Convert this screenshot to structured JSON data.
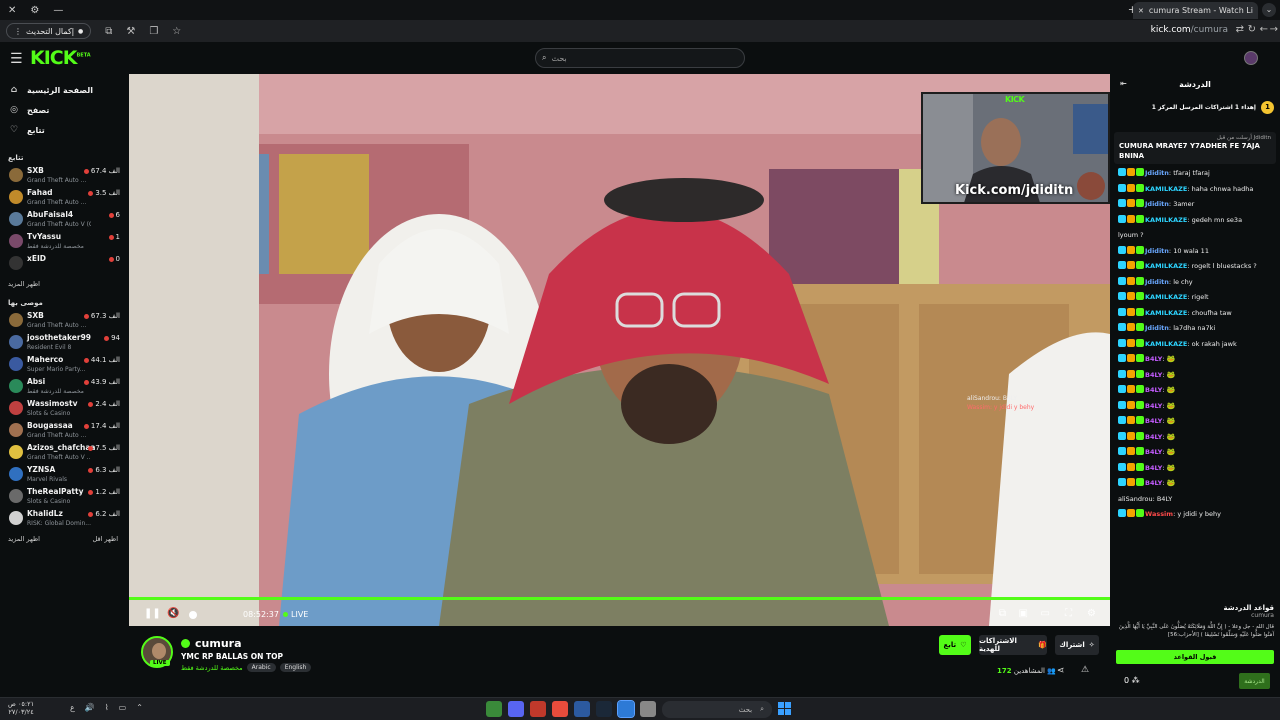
{
  "browser": {
    "tab_title": "cumura Stream - Watch Li",
    "update_label": "إكمال التحديث",
    "url_host": "kick.com",
    "url_path": "/cumura"
  },
  "header": {
    "logo": "KICK",
    "logo_sup": "BETA",
    "search_placeholder": "بحث"
  },
  "sidebar": {
    "nav": [
      {
        "label": "الصفحة الرئيسية",
        "icon": "home-icon"
      },
      {
        "label": "تصفح",
        "icon": "compass-icon"
      },
      {
        "label": "تتابع",
        "icon": "heart-icon"
      }
    ],
    "following_heading": "تتابع",
    "following": [
      {
        "name": "SXB",
        "game": "Grand Theft Auto ...",
        "viewers": "67.4 الف",
        "color": "#8a6a3a"
      },
      {
        "name": "Fahad",
        "game": "Grand Theft Auto ...",
        "viewers": "3.5 الف",
        "color": "#c08a2a"
      },
      {
        "name": "AbuFaisal4",
        "game": "Grand Theft Auto V (GTA)",
        "viewers": "6",
        "color": "#5a7a9a"
      },
      {
        "name": "TvYassu",
        "game": "مخصصة للدردشة فقط",
        "viewers": "1",
        "color": "#7a4a6a"
      },
      {
        "name": "xEID",
        "game": "",
        "viewers": "0",
        "color": "#333333"
      }
    ],
    "show_more": "اظهر المزيد",
    "recommended_heading": "موصى بها",
    "recommended": [
      {
        "name": "SXB",
        "game": "Grand Theft Auto ...",
        "viewers": "67.3 الف",
        "color": "#8a6a3a"
      },
      {
        "name": "josothetaker99",
        "game": "Resident Evil 8",
        "viewers": "94",
        "color": "#4a6aa0"
      },
      {
        "name": "Maherco",
        "game": "Super Mario Party...",
        "viewers": "44.1 الف",
        "color": "#3a5aa0"
      },
      {
        "name": "Absi",
        "game": "مخصصة للدردشة فقط",
        "viewers": "43.9 الف",
        "color": "#2a8a5a"
      },
      {
        "name": "Wassimostv",
        "game": "Slots & Casino",
        "viewers": "2.4 الف",
        "color": "#c04040"
      },
      {
        "name": "Bougassaa",
        "game": "Grand Theft Auto ...",
        "viewers": "17.4 الف",
        "color": "#a07050"
      },
      {
        "name": "Azizos_chafchaa",
        "game": "Grand Theft Auto V ...",
        "viewers": "7.5 الف",
        "color": "#e0c040"
      },
      {
        "name": "YZNSA",
        "game": "Marvel Rivals",
        "viewers": "6.3 الف",
        "color": "#3070c0"
      },
      {
        "name": "TheRealPatty",
        "game": "Slots & Casino",
        "viewers": "1.2 الف",
        "color": "#6a6a6a"
      },
      {
        "name": "KhalidLz",
        "game": "RISK: Global Domin...",
        "viewers": "6.2 الف",
        "color": "#d0d0d0"
      }
    ],
    "show_more2": "اظهر المزيد",
    "show_less": "اظهر اقل"
  },
  "player": {
    "cam_logo": "KICK",
    "cam_url": "Kick.com/jdiditn",
    "time": "08:52:37",
    "live": "LIVE",
    "overlay_chat": [
      "aliSandrou: B4LY",
      "Wassim: y jdidi y behy"
    ]
  },
  "stream": {
    "streamer": "cumura",
    "live_badge": "LIVE",
    "title": "YMC RP BALLAS ON TOP",
    "category": "مخصصة للدردشة فقط",
    "tags": [
      "Arabic",
      "English"
    ],
    "follow": "تابع",
    "subs": "الاشتراكات للهدية",
    "gift": "اشتراك",
    "viewers_label": "المشاهدين",
    "viewers": "172"
  },
  "chat": {
    "title": "الدردشة",
    "gift_count": "1",
    "gift_text": "إهداء 1 اشتراكات المرسل المركز 1",
    "pinned_by": "أرسلت من قبل Jdiditn",
    "pinned_msg": "CUMURA MRAYE7 Y7ADHER FE 7AJA BNINA",
    "messages": [
      {
        "user": "Jdiditn",
        "cls": "u1",
        "text": "tfaraj tfaraj"
      },
      {
        "user": "KAMILKAZE",
        "cls": "u2",
        "text": "haha chnwa hadha"
      },
      {
        "user": "Jdiditn",
        "cls": "u1",
        "text": "3amer"
      },
      {
        "user": "KAMILKAZE",
        "cls": "u2",
        "text": "gedeh mn se3a"
      },
      {
        "user": "",
        "cls": "",
        "text": "lyoum ?"
      },
      {
        "user": "Jdiditn",
        "cls": "u1",
        "text": "10 wala 11"
      },
      {
        "user": "KAMILKAZE",
        "cls": "u2",
        "text": "rogelt l bluestacks ?"
      },
      {
        "user": "Jdiditn",
        "cls": "u1",
        "text": "le chy"
      },
      {
        "user": "KAMILKAZE",
        "cls": "u2",
        "text": "rigelt"
      },
      {
        "user": "KAMILKAZE",
        "cls": "u2",
        "text": "choufha taw"
      },
      {
        "user": "Jdiditn",
        "cls": "u1",
        "text": "la7dha na7ki"
      },
      {
        "user": "KAMILKAZE",
        "cls": "u2",
        "text": "ok rakah jawk"
      },
      {
        "user": "B4LY",
        "cls": "u3",
        "text": ""
      },
      {
        "user": "B4LY",
        "cls": "u3",
        "text": ""
      },
      {
        "user": "B4LY",
        "cls": "u3",
        "text": ""
      },
      {
        "user": "B4LY",
        "cls": "u3",
        "text": ""
      },
      {
        "user": "B4LY",
        "cls": "u3",
        "text": ""
      },
      {
        "user": "B4LY",
        "cls": "u3",
        "text": ""
      },
      {
        "user": "B4LY",
        "cls": "u3",
        "text": ""
      },
      {
        "user": "B4LY",
        "cls": "u3",
        "text": ""
      },
      {
        "user": "B4LY",
        "cls": "u3",
        "text": ""
      },
      {
        "user": "aliSandrou",
        "cls": "",
        "text": "B4LY"
      },
      {
        "user": "Wassim",
        "cls": "u4",
        "text": "y jdidi y behy"
      }
    ],
    "rules_title": "قواعد الدردشة",
    "rules_sub": "cumura",
    "rules_body": "قال الله - جل وعلا - ( إِنَّ اللَّهَ وَمَلَائِكَتَهُ يُصَلُّونَ عَلَى النَّبِيِّ يَا أَيُّهَا الَّذِينَ آمَنُوا صَلُّوا عَلَيْهِ وَسَلِّمُوا تَسْلِيمًا ) [الأحزاب:56]",
    "accept": "قبول القواعد",
    "send": "الدردشة",
    "points": "0"
  },
  "taskbar": {
    "time": "٠٥:٢١ ص",
    "date": "٢٧/٠٣/٢٤",
    "search": "بحث",
    "lang": "ع"
  }
}
